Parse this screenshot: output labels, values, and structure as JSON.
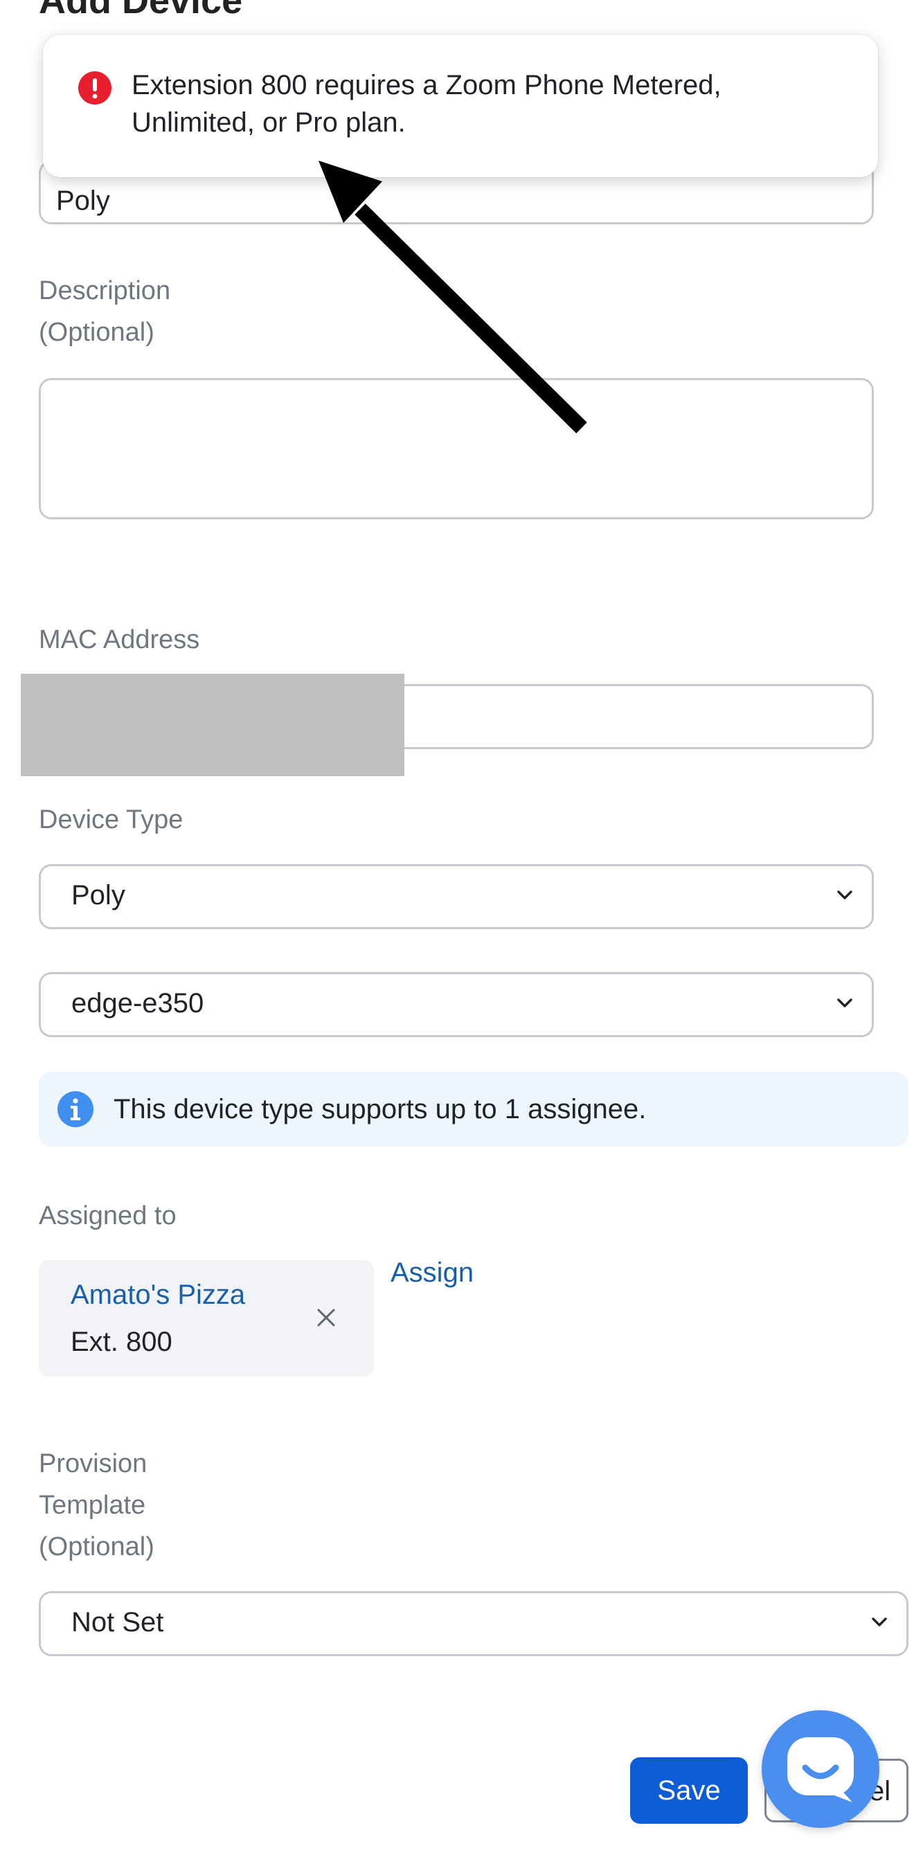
{
  "header": {
    "title": "Add Device"
  },
  "toast": {
    "message": "Extension 800 requires a Zoom Phone Metered, Unlimited, or Pro plan.",
    "icon": "error-icon",
    "icon_color": "#e8202e"
  },
  "form": {
    "name_value": "Poly",
    "description_label_line1": "Description",
    "description_label_line2": "(Optional)",
    "description_value": "",
    "mac_label": "MAC Address",
    "device_type_label": "Device Type",
    "manufacturer_value": "Poly",
    "model_value": "edge-e350",
    "info_text": "This device type supports up to 1 assignee.",
    "assigned_to_label": "Assigned to",
    "assignee": {
      "name": "Amato's Pizza",
      "extension": "Ext. 800"
    },
    "assign_link": "Assign",
    "provision_label_line1": "Provision",
    "provision_label_line2": "Template",
    "provision_label_line3": "(Optional)",
    "provision_value": "Not Set"
  },
  "actions": {
    "save_label": "Save",
    "cancel_visible_fragment": "el"
  },
  "colors": {
    "primary_button": "#0b5cd5",
    "link": "#1b5fa8",
    "info_background": "#eef5fd",
    "chat_button": "#4a8ef0"
  }
}
